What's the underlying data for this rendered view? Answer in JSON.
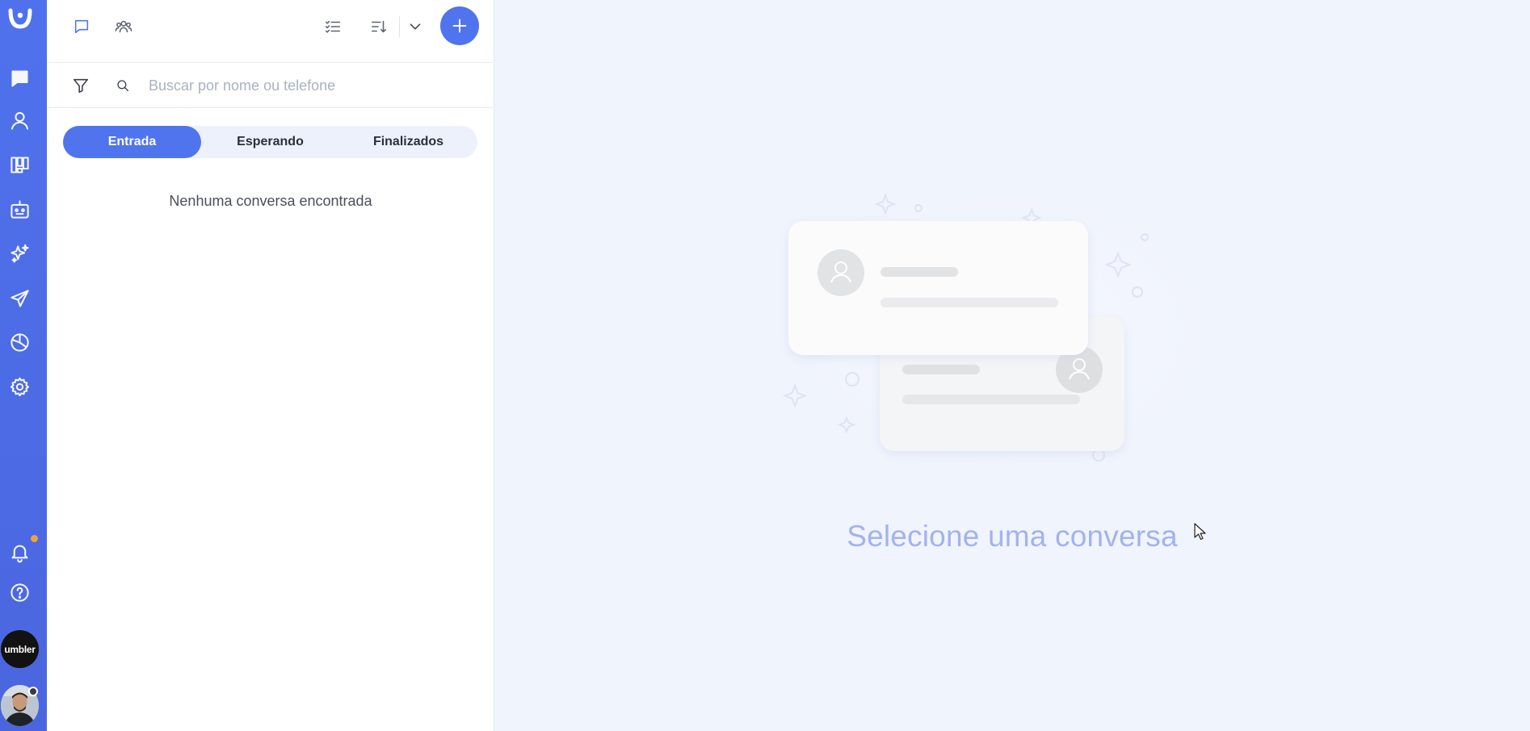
{
  "nav": {
    "items": [
      {
        "name": "conversations",
        "icon": "chat-bubble-icon"
      },
      {
        "name": "contacts",
        "icon": "user-icon"
      },
      {
        "name": "kanban",
        "icon": "kanban-board-icon"
      },
      {
        "name": "bots",
        "icon": "robot-icon"
      },
      {
        "name": "ai",
        "icon": "sparkles-icon"
      },
      {
        "name": "campaigns",
        "icon": "paper-plane-icon"
      },
      {
        "name": "reports",
        "icon": "pie-chart-icon"
      },
      {
        "name": "settings",
        "icon": "gear-icon"
      },
      {
        "name": "notifications",
        "icon": "bell-icon"
      },
      {
        "name": "help",
        "icon": "help-circle-icon"
      }
    ],
    "brand_label": "umbler",
    "notification_badge_color": "#f59e3b",
    "accent_color": "#4f74ee"
  },
  "toolbar": {
    "chat_icon": "chat-bubble-icon",
    "groups_icon": "users-group-icon",
    "checklist_icon": "checklist-icon",
    "sort_icon": "sort-icon",
    "dropdown_icon": "chevron-down-icon",
    "add_icon": "plus-icon"
  },
  "search": {
    "filter_icon": "filter-icon",
    "search_icon": "search-icon",
    "placeholder": "Buscar por nome ou telefone",
    "value": ""
  },
  "tabs": {
    "items": [
      {
        "label": "Entrada",
        "active": true
      },
      {
        "label": "Esperando",
        "active": false
      },
      {
        "label": "Finalizados",
        "active": false
      }
    ]
  },
  "list": {
    "empty_message": "Nenhuma conversa encontrada"
  },
  "main": {
    "empty_title": "Selecione uma conversa"
  }
}
